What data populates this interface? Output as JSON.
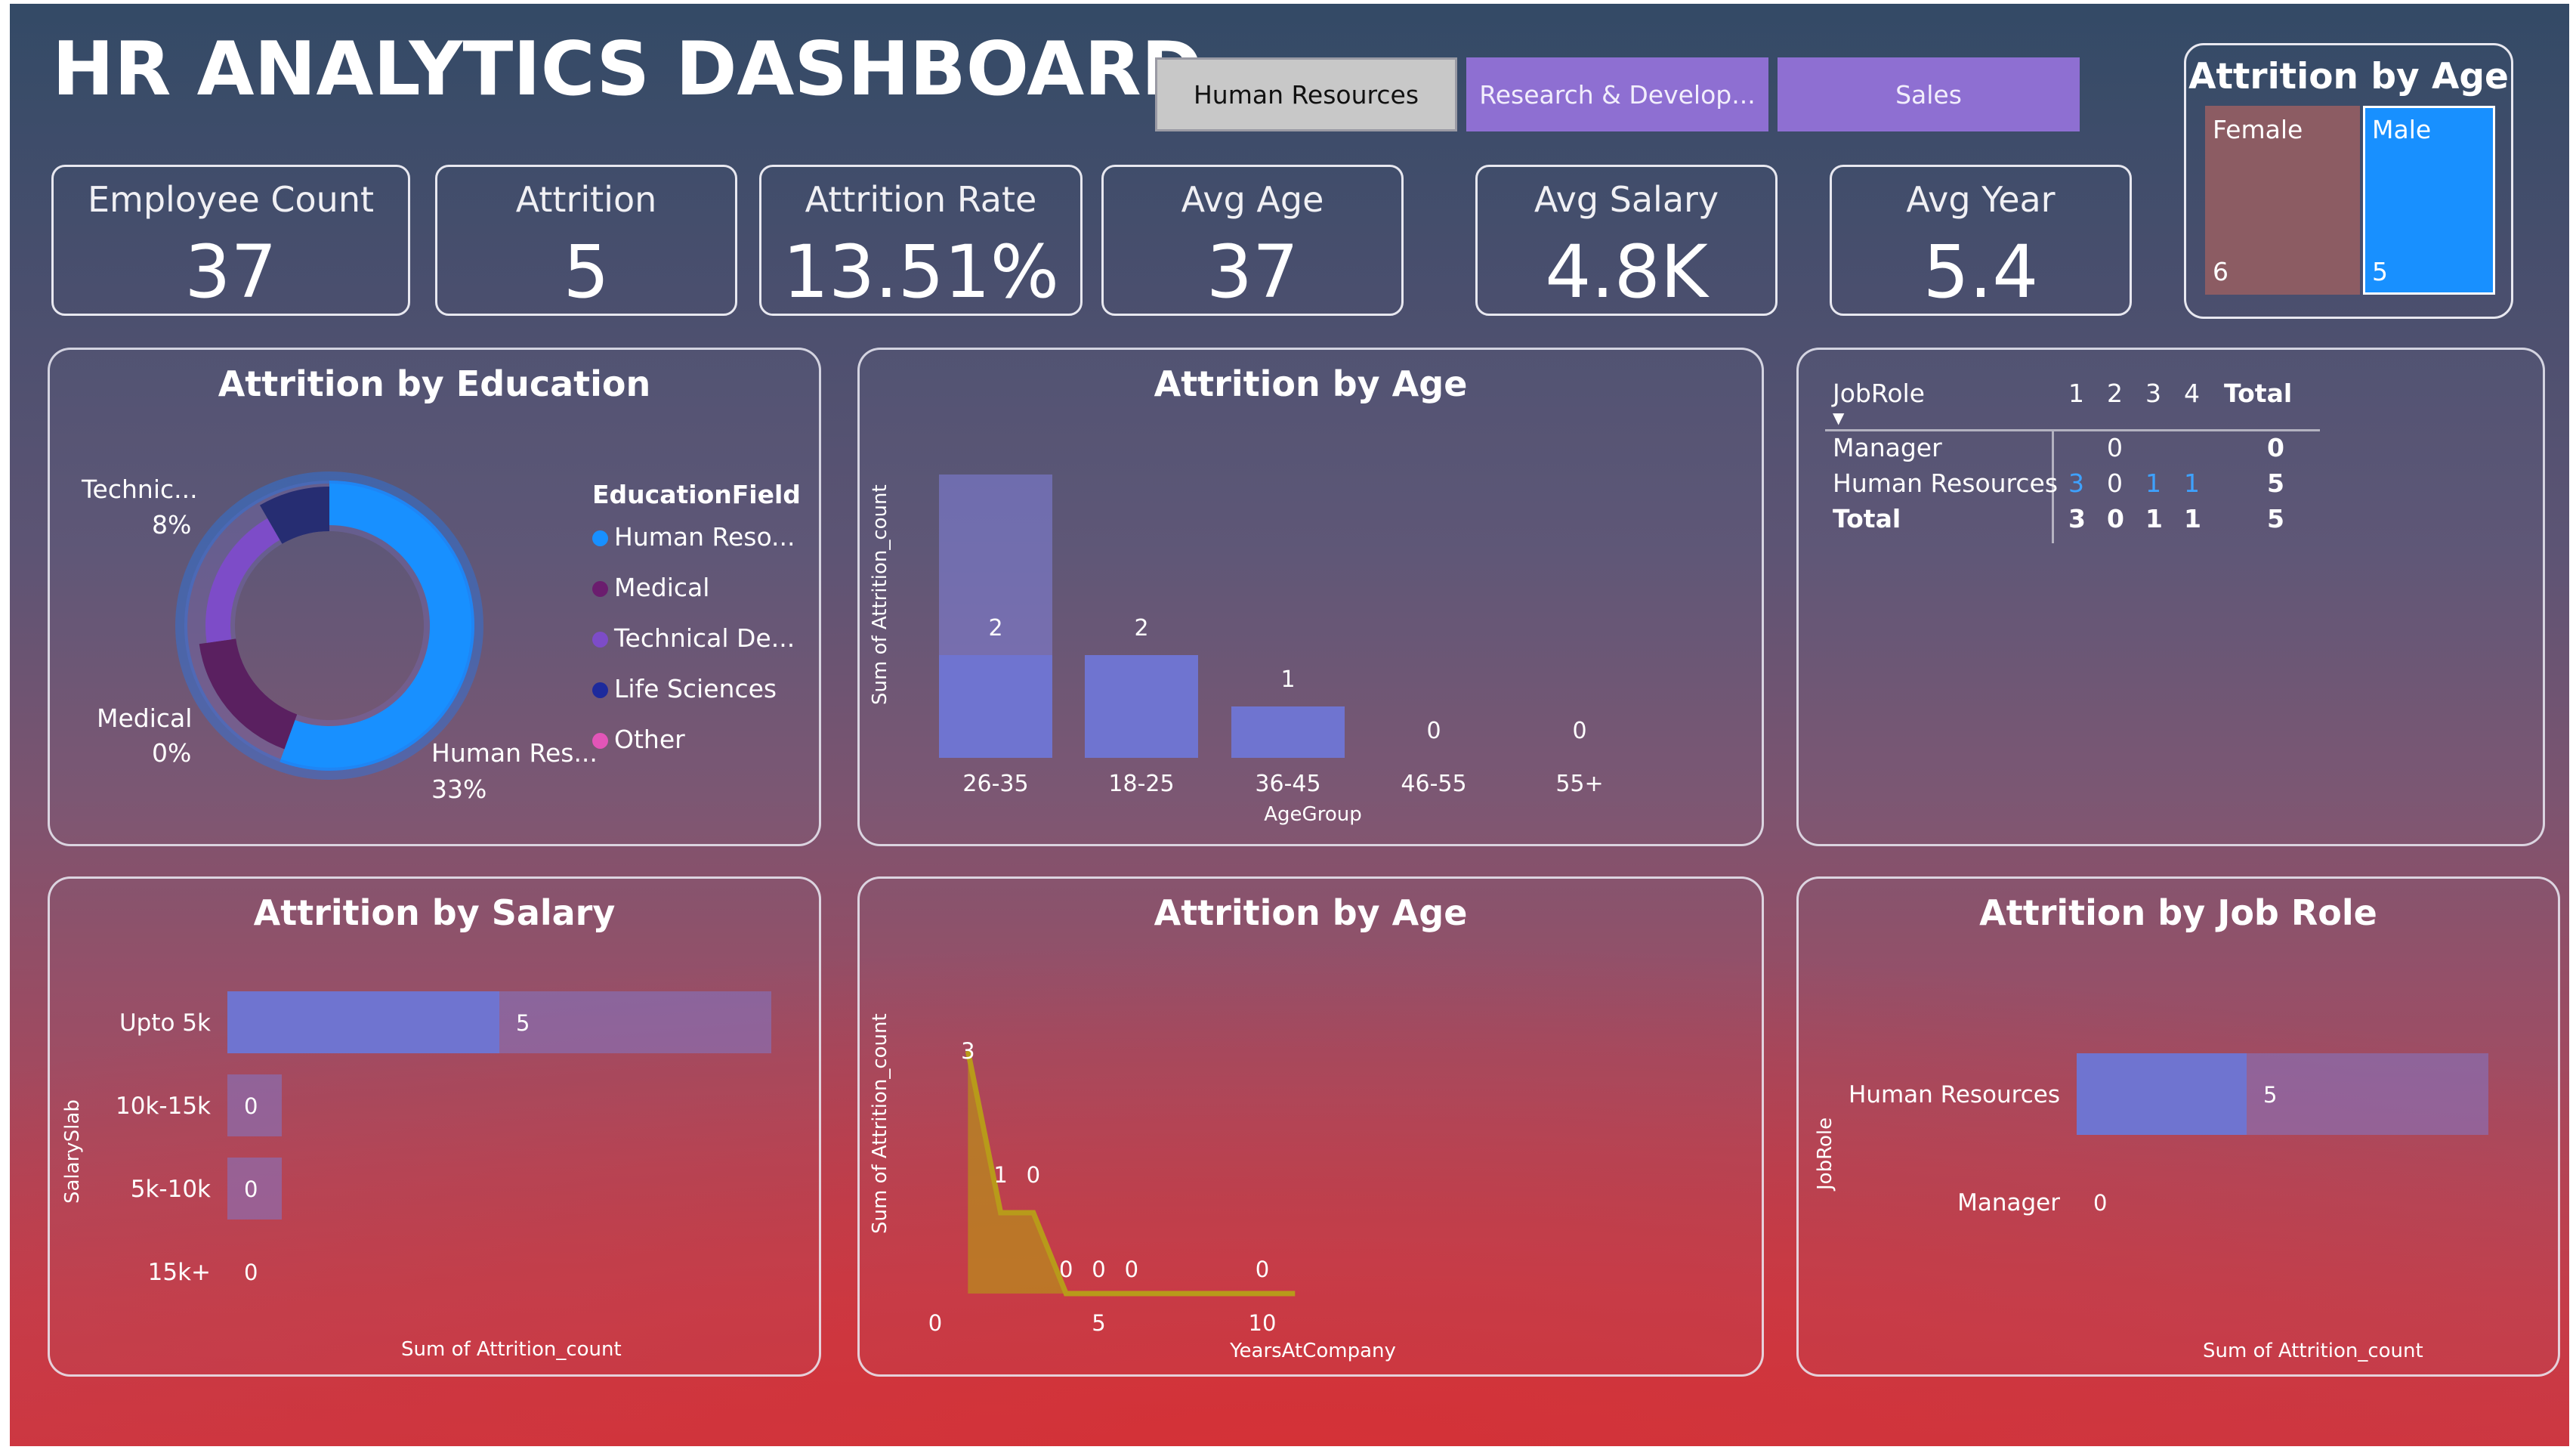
{
  "header": {
    "title": "HR ANALYTICS DASHBOARD"
  },
  "slicer": {
    "items": [
      {
        "label": "Human Resources",
        "selected": true
      },
      {
        "label": "Research & Develop...",
        "selected": false
      },
      {
        "label": "Sales",
        "selected": false
      }
    ]
  },
  "kpis": [
    {
      "label": "Employee Count",
      "value": "37"
    },
    {
      "label": "Attrition",
      "value": "5"
    },
    {
      "label": "Attrition Rate",
      "value": "13.51%"
    },
    {
      "label": "Avg Age",
      "value": "37"
    },
    {
      "label": "Avg Salary",
      "value": "4.8K"
    },
    {
      "label": "Avg Year",
      "value": "5.4"
    }
  ],
  "gender_card": {
    "title": "Attrition by Age",
    "female_label": "Female",
    "female_value": "6",
    "male_label": "Male",
    "male_value": "5"
  },
  "education": {
    "title": "Attrition by Education",
    "legend_title": "EducationField",
    "legend": [
      "Human Reso...",
      "Medical",
      "Technical De...",
      "Life Sciences",
      "Other"
    ],
    "labels": {
      "technical_name": "Technic...",
      "technical_pct": "8%",
      "medical_name": "Medical",
      "medical_pct": "0%",
      "hr_name": "Human Res...",
      "hr_pct": "33%"
    }
  },
  "matrix": {
    "header_label": "JobRole",
    "columns": [
      "1",
      "2",
      "3",
      "4",
      "Total"
    ],
    "rows": [
      {
        "name": "Manager",
        "c1": "",
        "c2": "0",
        "c3": "",
        "c4": "",
        "total": "0"
      },
      {
        "name": "Human Resources",
        "c1": "3",
        "c2": "0",
        "c3": "1",
        "c4": "1",
        "total": "5"
      },
      {
        "name": "Total",
        "c1": "3",
        "c2": "0",
        "c3": "1",
        "c4": "1",
        "total": "5"
      }
    ]
  },
  "age_bar": {
    "title": "Attrition by Age",
    "xlabel": "AgeGroup",
    "ylabel": "Sum of Attrition_count"
  },
  "salary": {
    "title": "Attrition by Salary",
    "xlabel": "Sum of Attrition_count",
    "ylabel": "SalarySlab"
  },
  "years": {
    "title": "Attrition by Age",
    "xlabel": "YearsAtCompany",
    "ylabel": "Sum of Attrition_count"
  },
  "jobrole": {
    "title": "Attrition by Job Role",
    "xlabel": "Sum of Attrition_count",
    "ylabel": "JobRole"
  },
  "colors": {
    "accent_blue": "#1890ff",
    "bar_purple": "#6f74d0",
    "slicer_purple": "#8e6fd2",
    "area_gold": "#b88a1e",
    "female_brown": "#8c5c63"
  },
  "chart_data": [
    {
      "type": "pie",
      "chart": "education_donut",
      "categories": [
        "Human Resources",
        "Medical",
        "Technical Degree",
        "Life Sciences",
        "Other"
      ],
      "values": [
        33,
        0,
        8,
        0,
        0
      ],
      "legend_title": "EducationField",
      "data_labels": [
        "33%",
        "0%",
        "8%"
      ]
    },
    {
      "type": "bar",
      "chart": "age_group",
      "categories": [
        "26-35",
        "18-25",
        "36-45",
        "46-55",
        "55+"
      ],
      "values": [
        2,
        2,
        1,
        0,
        0
      ],
      "xlabel": "AgeGroup",
      "ylabel": "Sum of Attrition_count"
    },
    {
      "type": "bar",
      "chart": "salary_slab",
      "orientation": "horizontal",
      "categories": [
        "Upto 5k",
        "10k-15k",
        "5k-10k",
        "15k+"
      ],
      "values": [
        5,
        0,
        0,
        0
      ],
      "xlabel": "Sum of Attrition_count",
      "ylabel": "SalarySlab"
    },
    {
      "type": "area",
      "chart": "years_at_company",
      "x": [
        1,
        2,
        3,
        4,
        5,
        6,
        10,
        11
      ],
      "y": [
        3,
        1,
        1,
        0,
        0,
        0,
        0,
        0
      ],
      "data_labels": [
        "3",
        "1",
        "0",
        "0",
        "0",
        "0",
        "0"
      ],
      "x_ticks": [
        "0",
        "5",
        "10"
      ],
      "xlim": [
        0,
        11
      ],
      "xlabel": "YearsAtCompany",
      "ylabel": "Sum of Attrition_count"
    },
    {
      "type": "bar",
      "chart": "job_role",
      "orientation": "horizontal",
      "categories": [
        "Human Resources",
        "Manager"
      ],
      "values": [
        5,
        0
      ],
      "xlabel": "Sum of Attrition_count",
      "ylabel": "JobRole"
    }
  ]
}
